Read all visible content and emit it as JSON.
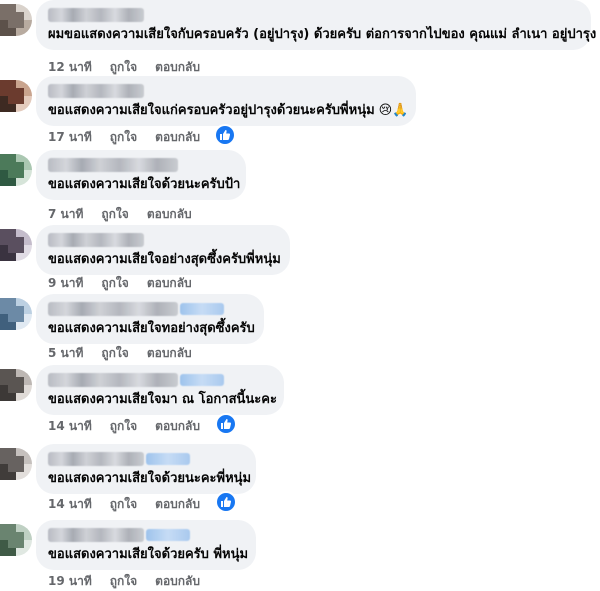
{
  "comments": [
    {
      "text": "ผมขอแสดงความเสียใจกับครอบครัว (อยู่ปารุง) ด้วยครับ ต่อการจากไปของ คุณแม่ ลำเนา อยู่ปารุง",
      "time": "12 นาที",
      "like_label": "ถูกใจ",
      "reply_label": "ตอบกลับ",
      "has_reaction": false
    },
    {
      "text": "ขอแสดงความเสียใจแก่ครอบครัวอยู่ปารุงด้วยนะครับพี่หนุ่ม",
      "emoji": "😢🙏",
      "time": "17 นาที",
      "like_label": "ถูกใจ",
      "reply_label": "ตอบกลับ",
      "has_reaction": true
    },
    {
      "text": "ขอแสดงความเสียใจด้วยนะครับป้า",
      "time": "7 นาที",
      "like_label": "ถูกใจ",
      "reply_label": "ตอบกลับ",
      "has_reaction": false
    },
    {
      "text": "ขอแสดงความเสียใจอย่างสุดซึ้งครับพี่หนุ่ม",
      "time": "9 นาที",
      "like_label": "ถูกใจ",
      "reply_label": "ตอบกลับ",
      "has_reaction": false
    },
    {
      "text": "ขอแสดงความเสียใจทอย่างสุดซึ้งครับ",
      "time": "5 นาที",
      "like_label": "ถูกใจ",
      "reply_label": "ตอบกลับ",
      "has_reaction": false
    },
    {
      "text": "ขอแสดงความเสียใจมา ณ โอกาสนี้นะคะ",
      "time": "14 นาที",
      "like_label": "ถูกใจ",
      "reply_label": "ตอบกลับ",
      "has_reaction": true
    },
    {
      "text": "ขอแสดงความเสียใจด้วยนะคะพี่หนุ่ม",
      "time": "14 นาที",
      "like_label": "ถูกใจ",
      "reply_label": "ตอบกลับ",
      "has_reaction": true
    },
    {
      "text": "ขอแสดงความเสียใจด้วยครับ พี่หนุ่ม",
      "time": "19 นาที",
      "like_label": "ถูกใจ",
      "reply_label": "ตอบกลับ",
      "has_reaction": false
    }
  ],
  "colors": {
    "bubble": "#f0f2f5",
    "meta": "#65676b",
    "like_reaction": "#1877f2"
  },
  "icons": {
    "reaction": "like-thumb-icon"
  }
}
